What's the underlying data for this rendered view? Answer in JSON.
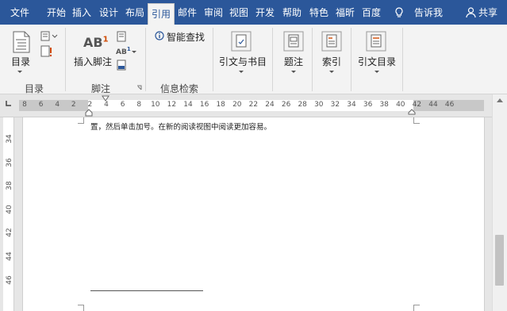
{
  "tabs": [
    {
      "label": "文件",
      "active": false
    },
    {
      "label": "开始",
      "active": false
    },
    {
      "label": "插入",
      "active": false
    },
    {
      "label": "设计",
      "active": false
    },
    {
      "label": "布局",
      "active": false
    },
    {
      "label": "引用",
      "active": true
    },
    {
      "label": "邮件",
      "active": false
    },
    {
      "label": "审阅",
      "active": false
    },
    {
      "label": "视图",
      "active": false
    },
    {
      "label": "开发",
      "active": false
    },
    {
      "label": "帮助",
      "active": false
    },
    {
      "label": "特色",
      "active": false
    },
    {
      "label": "福昕",
      "active": false
    },
    {
      "label": "百度",
      "active": false
    }
  ],
  "tell_me": "告诉我",
  "share": "共享",
  "ribbon": {
    "toc_label": "目录",
    "toc_group": "目录",
    "insert_footnote_label": "插入脚注",
    "footnote_group": "脚注",
    "ab_big": "AB",
    "ab_sup": "1",
    "ab_small": "AB",
    "ab_small_sup": "1",
    "smart_lookup_label": "智能查找",
    "research_group": "信息检索",
    "citations_label": "引文与书目",
    "caption_label": "题注",
    "index_label": "索引",
    "toa_label": "引文目录"
  },
  "ruler": {
    "ticks": [
      "8",
      "6",
      "4",
      "2",
      "2",
      "4",
      "6",
      "8",
      "10",
      "12",
      "14",
      "16",
      "18",
      "20",
      "22",
      "24",
      "26",
      "28",
      "30",
      "32",
      "34",
      "36",
      "38",
      "40",
      "42",
      "44",
      "46"
    ]
  },
  "vruler": {
    "ticks": [
      "34",
      "36",
      "38",
      "40",
      "42",
      "44",
      "46"
    ]
  },
  "document": {
    "text": "置，然后单击加号。在新的阅读视图中阅读更加容易。"
  },
  "colors": {
    "tab_bar": "#2b579a",
    "ribbon_bg": "#f3f3f3",
    "page_bg": "#ffffff"
  }
}
